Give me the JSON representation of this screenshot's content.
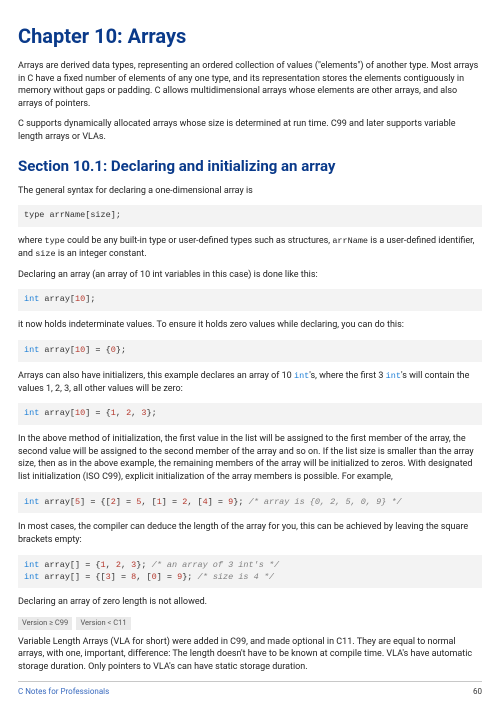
{
  "title": "Chapter 10: Arrays",
  "intro1": "Arrays are derived data types, representing an ordered collection of values (\"elements\") of another type. Most arrays in C have a fixed number of elements of any one type, and its representation stores the elements contiguously in memory without gaps or padding. C allows multidimensional arrays whose elements are other arrays, and also arrays of pointers.",
  "intro2": "C supports dynamically allocated arrays whose size is determined at run time. C99 and later supports variable length arrays or VLAs.",
  "section_title": "Section 10.1: Declaring and initializing an array",
  "p1": "The general syntax for declaring a one-dimensional array is",
  "c1": {
    "pre": "type arrName",
    "open": "[",
    "mid": "size",
    "close": "]",
    "tail": ";"
  },
  "p2a": "where ",
  "p2_type": "type",
  "p2b": " could be any built-in type or user-defined types such as structures, ",
  "p2_arr": "arrName",
  "p2c": " is a user-defined identifier, and ",
  "p2_size": "size",
  "p2d": " is an integer constant.",
  "p3": "Declaring an array (an array of 10 int variables in this case) is done like this:",
  "c2": {
    "kw": "int",
    "name": " array",
    "open": "[",
    "n": "10",
    "close": "]",
    "tail": ";"
  },
  "p4": "it now holds indeterminate values. To ensure it holds zero values while declaring, you can do this:",
  "c3": {
    "kw": "int",
    "name": " array",
    "open": "[",
    "n": "10",
    "mid": "] = {",
    "z": "0",
    "tail": "};"
  },
  "p5a": "Arrays can also have initializers, this example declares an array of 10 ",
  "p5_int": "int",
  "p5b": "'s, where the first 3 ",
  "p5c": "'s will contain the values 1, 2, 3, all other values will be zero:",
  "c4": {
    "kw": "int",
    "name": " array",
    "open": "[",
    "n": "10",
    "mid": "] = {",
    "v1": "1",
    "s1": ", ",
    "v2": "2",
    "s2": ", ",
    "v3": "3",
    "tail": "};"
  },
  "p6": "In the above method of initialization, the first value in the list will be assigned to the first member of the array, the second value will be assigned to the second member of the array and so on. If the list size is smaller than the array size, then as in the above example, the remaining members of the array will be initialized to zeros. With designated list initialization (ISO C99), explicit initialization of the array members is possible. For example,",
  "c5": {
    "kw": "int",
    "name": " array",
    "open": "[",
    "n": "5",
    "m1": "] = {[",
    "i2": "2",
    "m2": "] = ",
    "v5": "5",
    "m3": ", [",
    "i1": "1",
    "m4": "] = ",
    "v2": "2",
    "m5": ", [",
    "i4": "4",
    "m6": "] = ",
    "v9": "9",
    "m7": "}; ",
    "cmt": "/* array is {0, 2, 5, 0, 9} */"
  },
  "p7": "In most cases, the compiler can deduce the length of the array for you, this can be achieved by leaving the square brackets empty:",
  "c6a": {
    "kw": "int",
    "name": " array",
    "open": "[] = {",
    "v1": "1",
    "s1": ", ",
    "v2": "2",
    "s2": ", ",
    "v3": "3",
    "close": "}; ",
    "cmt": "/* an array of 3 int's */"
  },
  "c6b": {
    "kw": "int",
    "name": " array",
    "open": "[] = {[",
    "i3": "3",
    "m1": "] = ",
    "v8": "8",
    "m2": ", [",
    "i0": "0",
    "m3": "] = ",
    "v9": "9",
    "close": "}; ",
    "cmt": "/* size is 4 */"
  },
  "p8": "Declaring an array of zero length is not allowed.",
  "vers": {
    "a": "Version ≥ C99",
    "b": "Version < C11"
  },
  "p9": "Variable Length Arrays (VLA for short) were added in C99, and made optional in C11. They are equal to normal arrays, with one, important, difference: The length doesn't have to be known at compile time. VLA's have automatic storage duration. Only pointers to VLA's can have static storage duration.",
  "footer": {
    "left": "C Notes for Professionals",
    "page": "60"
  }
}
